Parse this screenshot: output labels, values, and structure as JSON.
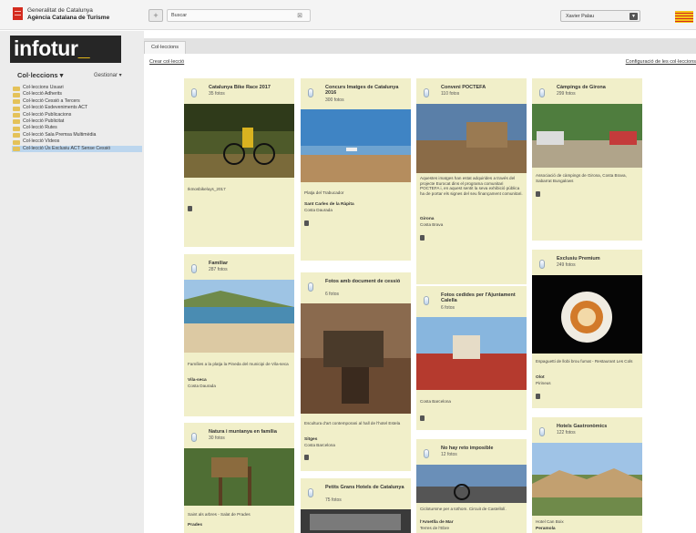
{
  "header": {
    "org_line1": "Generalitat de Catalunya",
    "org_line2": "Agència Catalana de Turisme",
    "search_label": "Buscar",
    "user_name": "Xavier Palau"
  },
  "sidebar": {
    "logo": "infotur",
    "logo_underscore": "_",
    "collections_title": "Col·leccions ▾",
    "manage_label": "Gestionar ▾",
    "items": [
      {
        "label": "Col·leccions Usuari"
      },
      {
        "label": "Col·lecció Adherits"
      },
      {
        "label": "Col·lecció Cessió a Tercers"
      },
      {
        "label": "Col·lecció Esdeveniments ACT"
      },
      {
        "label": "Col·lecció Publicacions"
      },
      {
        "label": "Col·lecció Publicitat"
      },
      {
        "label": "Col·lecció Rutes"
      },
      {
        "label": "Col·lecció Sala Premsa Multimèdia"
      },
      {
        "label": "Col·lecció Vídeos"
      },
      {
        "label": "Col·lecció Ús Exclusiu ACT Sense Cessió"
      }
    ]
  },
  "main": {
    "tab_label": "Col·leccions",
    "create_link": "Crear col·lecció",
    "config_link": "Configuració de les col·leccions"
  },
  "cards": [
    {
      "title": "Catalunya Bike Race 2017",
      "count": "35 fotos",
      "desc": "Ikmosbikeluys_2017",
      "place": "",
      "region": ""
    },
    {
      "title": "Concurs Imatges de Catalunya 2016",
      "count": "300 fotos",
      "desc": "Platja del Trabucador",
      "place": "Sant Carles de la Ràpita",
      "region": "Costa Daurada"
    },
    {
      "title": "Conveni POCTEFA",
      "count": "110 fotos",
      "desc": "Aquestes imatges han estat adquirides a través del projecte Eurocat dins el programa comunitari POCTEFA i, en aquest sentit la seva exhibició pública ha de portar els signes del seu finançament comunitari.",
      "place": "Girona",
      "region": "Costa Brava"
    },
    {
      "title": "Càmpings de Girona",
      "count": "299 fotos",
      "desc": "Associació de càmpings de Girona, Costa Brava, Sabarrat Bungalows",
      "place": "",
      "region": ""
    },
    {
      "title": "Familiar",
      "count": "287 fotos",
      "desc": "Famílies a la platja la Pineda del municipi de Vila-seca",
      "place": "Vila-seca",
      "region": "Costa Daurada"
    },
    {
      "title": "Fotos amb document de cessió",
      "count": "6 fotos",
      "desc": "Escultura d'art contemporani al hall de l'hotel Estela",
      "place": "Sitges",
      "region": "Costa Barcelona"
    },
    {
      "title": "Fotos cedides per l'Ajuntament Calella",
      "count": "6 fotos",
      "desc": "Costa Barcelona",
      "place": "",
      "region": ""
    },
    {
      "title": "Exclusiu Premium",
      "count": "249 fotos",
      "desc": "Espaguetti de llobi brou fumat - Restaurant Les Cols",
      "place": "Olot",
      "region": "Pirineus"
    },
    {
      "title": "Natura i muntanya en família",
      "count": "30 fotos",
      "desc": "Saint als arbres - Salat de Prades",
      "place": "Prades",
      "region": ""
    },
    {
      "title": "Petits Grans Hotels de Catalunya",
      "count": "75 fotos",
      "desc": "",
      "place": "",
      "region": ""
    },
    {
      "title": "No hay reto imposible",
      "count": "12 fotos",
      "desc": "Ciclotursme per a tothom. Circuit de Castellolí.",
      "place": "l'Ametlla de Mar",
      "region": "Terres de l'Ebre"
    },
    {
      "title": "Hotels Gastronòmics",
      "count": "122 fotos",
      "desc": "Hotel Can Boix",
      "place": "Peramola",
      "region": "Pirineus"
    }
  ],
  "colors": {
    "card_bg": "#f1efc9",
    "sidebar_bg": "#ececec",
    "logo_bg": "#262626",
    "accent_yellow": "#f5c518",
    "brand_red": "#d42b1e",
    "active_item": "#bcd6ee"
  }
}
